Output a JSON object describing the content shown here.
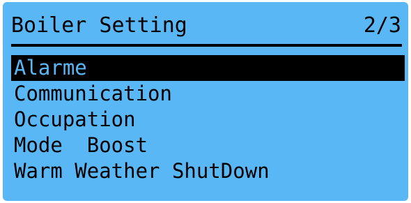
{
  "header": {
    "title": "Boiler Setting",
    "page_indicator": "2/3"
  },
  "menu": {
    "selected_index": 0,
    "items": [
      {
        "label": "Alarme"
      },
      {
        "label": "Communication"
      },
      {
        "label": "Occupation"
      },
      {
        "label": "Mode  Boost"
      },
      {
        "label": "Warm Weather ShutDown"
      }
    ]
  },
  "colors": {
    "screen_background": "#5ab7f5",
    "text": "#000000",
    "highlight_background": "#000000",
    "highlight_text": "#5ab7f5"
  }
}
